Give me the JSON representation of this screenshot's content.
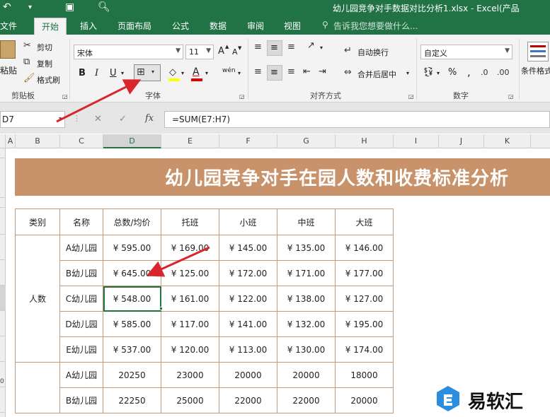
{
  "window": {
    "title": "幼儿园竞争对手数据对比分析1.xlsx - Excel(产品"
  },
  "tabs": [
    {
      "label": "文件"
    },
    {
      "label": "开始"
    },
    {
      "label": "插入"
    },
    {
      "label": "页面布局"
    },
    {
      "label": "公式"
    },
    {
      "label": "数据"
    },
    {
      "label": "审阅"
    },
    {
      "label": "视图"
    }
  ],
  "tell_me": "告诉我您想要做什么...",
  "ribbon": {
    "clipboard": {
      "paste": "粘贴",
      "cut": "剪切",
      "copy": "复制",
      "format_painter": "格式刷",
      "group": "剪贴板"
    },
    "font": {
      "name": "宋体",
      "size": "11",
      "bold": "B",
      "italic": "I",
      "underline": "U",
      "increase": "A",
      "decrease": "A",
      "phonetic": "wén",
      "group": "字体"
    },
    "alignment": {
      "wrap": "自动换行",
      "merge": "合并后居中",
      "group": "对齐方式"
    },
    "number": {
      "format": "自定义",
      "percent": "%",
      "comma": ",",
      "group": "数字"
    },
    "styles": {
      "conditional": "条件格式"
    }
  },
  "formula_bar": {
    "name_box": "D7",
    "cancel": "✕",
    "enter": "✓",
    "fx": "fx",
    "formula": "=SUM(E7:H7)"
  },
  "columns": [
    "A",
    "B",
    "C",
    "D",
    "E",
    "F",
    "G",
    "H",
    "I",
    "J",
    "K"
  ],
  "row_numbers": [
    "0"
  ],
  "sheet": {
    "banner": "幼儿园竞争对手在园人数和收费标准分析",
    "headers": [
      "类别",
      "名称",
      "总数/均价",
      "托班",
      "小班",
      "中班",
      "大班"
    ],
    "group1_label": "人数",
    "rows": [
      [
        "A幼儿园",
        "¥ 595.00",
        "¥ 169.00",
        "¥ 145.00",
        "¥ 135.00",
        "¥ 146.00"
      ],
      [
        "B幼儿园",
        "¥ 645.00",
        "¥ 125.00",
        "¥ 172.00",
        "¥ 171.00",
        "¥ 177.00"
      ],
      [
        "C幼儿园",
        "¥ 548.00",
        "¥ 161.00",
        "¥ 122.00",
        "¥ 138.00",
        "¥ 127.00"
      ],
      [
        "D幼儿园",
        "¥ 585.00",
        "¥ 117.00",
        "¥ 141.00",
        "¥ 132.00",
        "¥ 195.00"
      ],
      [
        "E幼儿园",
        "¥ 537.00",
        "¥ 120.00",
        "¥ 113.00",
        "¥ 130.00",
        "¥ 174.00"
      ]
    ],
    "rows2": [
      [
        "A幼儿园",
        "20250",
        "23000",
        "20000",
        "20000",
        "18000"
      ],
      [
        "B幼儿园",
        "22250",
        "25000",
        "22000",
        "22000",
        "20000"
      ]
    ]
  },
  "watermark": {
    "text": "易软汇"
  },
  "colors": {
    "excel_green": "#217346",
    "banner": "#c8926a",
    "arrow": "#d9262c"
  }
}
